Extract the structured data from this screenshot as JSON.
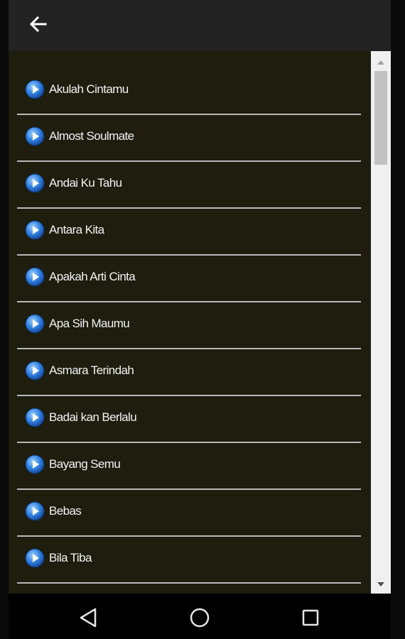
{
  "appbar": {
    "back_icon": "arrow-left-icon"
  },
  "songs": [
    "Akulah Cintamu",
    "Almost Soulmate",
    "Andai Ku Tahu",
    "Antara Kita",
    "Apakah Arti Cinta",
    "Apa Sih Maumu",
    "Asmara Terindah",
    "Badai kan Berlalu",
    "Bayang Semu",
    "Bebas",
    "Bila Tiba",
    ""
  ],
  "scrollbar": {
    "position_fraction": 0.0,
    "visible_fraction": 0.17
  },
  "navbar": {
    "icons": [
      "back-triangle-icon",
      "home-circle-icon",
      "recents-square-icon"
    ]
  },
  "colors": {
    "list_background": "#1e1d0e",
    "divider": "#b9b9b9",
    "text": "#f2f2f2",
    "play_icon": "#2f7fe0"
  }
}
